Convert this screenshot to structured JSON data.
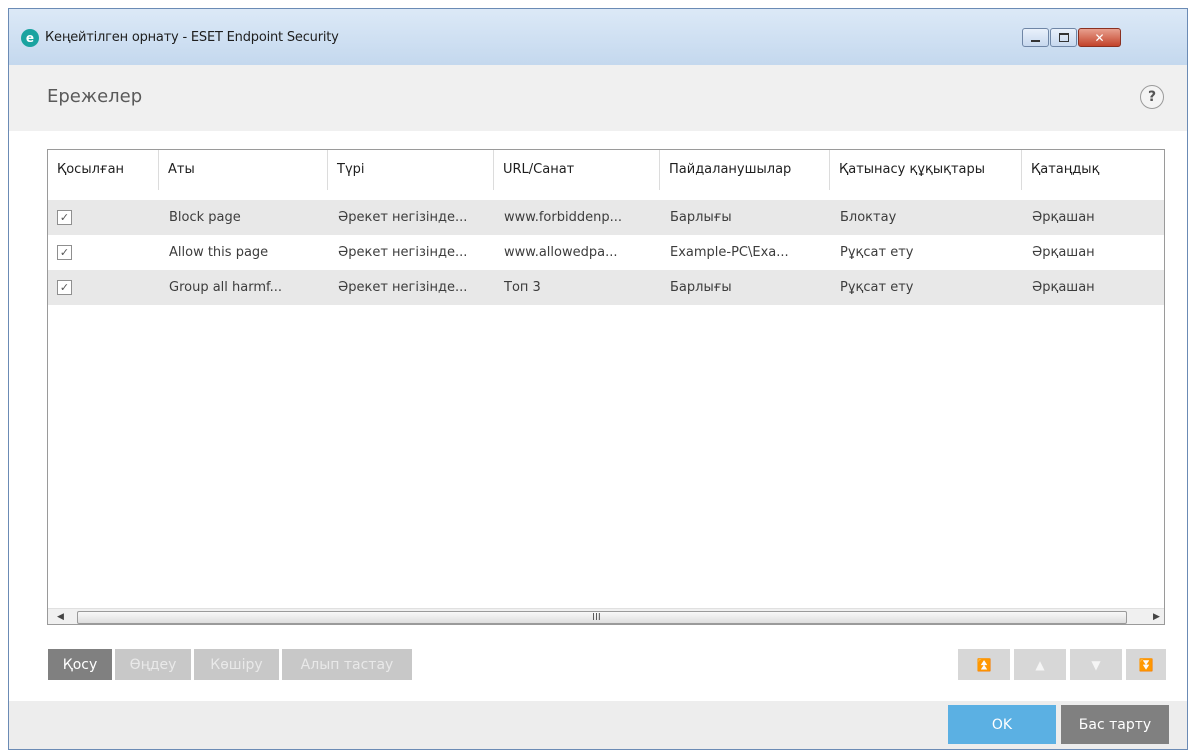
{
  "window": {
    "title": "Кеңейтілген орнату - ESET Endpoint Security",
    "app_icon": "eset-logo-icon",
    "app_icon_glyph": "e",
    "close_glyph": "✕"
  },
  "header": {
    "title": "Ережелер",
    "help_glyph": "?"
  },
  "table": {
    "columns": [
      "Қосылған",
      "Аты",
      "Түрі",
      "URL/Санат",
      "Пайдаланушылар",
      "Қатынасу құқықтары",
      "Қатаңдық"
    ],
    "rows": [
      {
        "enabled": true,
        "name": "Block page",
        "type": "Әрекет негізінде...",
        "url": "www.forbiddenp...",
        "users": "Барлығы",
        "access": "Блоктау",
        "severity": "Әрқашан"
      },
      {
        "enabled": true,
        "name": "Allow this page",
        "type": "Әрекет негізінде...",
        "url": "www.allowedpa...",
        "users": "Example-PC\\Exa...",
        "access": "Рұқсат ету",
        "severity": "Әрқашан"
      },
      {
        "enabled": true,
        "name": "Group all harmf...",
        "type": "Әрекет негізінде...",
        "url": "Топ 3",
        "users": "Барлығы",
        "access": "Рұқсат ету",
        "severity": "Әрқашан"
      }
    ],
    "check_glyph": "✓",
    "scroll_grip": "III",
    "scroll_left": "◀",
    "scroll_right": "▶"
  },
  "actions": {
    "add": "Қосу",
    "edit": "Өңдеу",
    "copy": "Көшіру",
    "remove": "Алып тастау"
  },
  "move": {
    "top": "⏫",
    "up": "▲",
    "down": "▼",
    "bottom": "⏬"
  },
  "footer": {
    "ok": "OK",
    "cancel": "Бас тарту"
  },
  "colors": {
    "ok_button": "#5bb0e3",
    "primary_button": "#808080",
    "disabled_button": "#c8c8c8",
    "row_alt": "#e8e8e8",
    "brand": "#1aa3a0"
  }
}
